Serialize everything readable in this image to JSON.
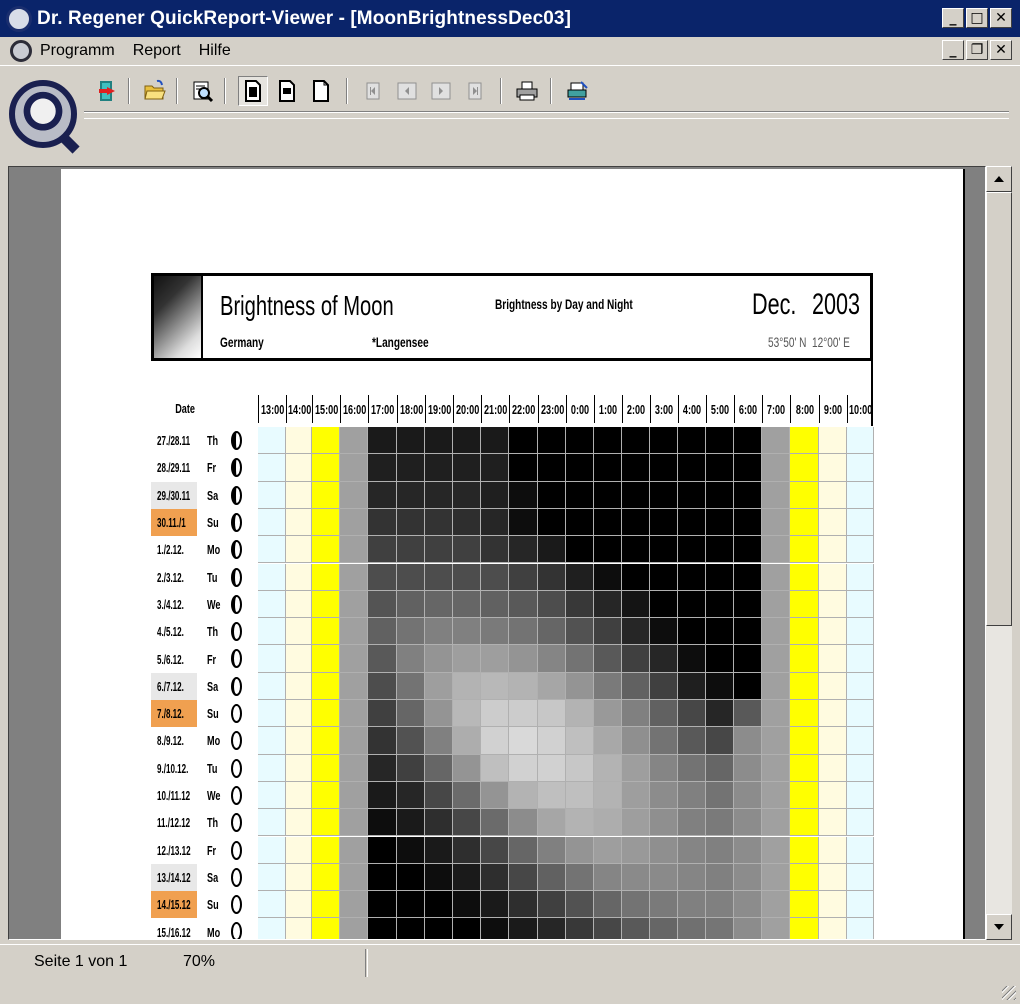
{
  "window": {
    "title": "Dr. Regener QuickReport-Viewer - [MoonBrightnessDec03]"
  },
  "menu": {
    "items": [
      "Programm",
      "Report",
      "Hilfe"
    ]
  },
  "toolbar": {
    "buttons": [
      "exit-icon",
      "open-folder-icon",
      "zoom-icon",
      "page-fit-icon",
      "page-width-icon",
      "page-100-icon",
      "first-page-icon",
      "prev-page-icon",
      "next-page-icon",
      "last-page-icon",
      "print-icon",
      "printer-setup-icon"
    ]
  },
  "report": {
    "title": "Brightness of Moon",
    "subtitle": "Brightness by Day and Night",
    "month": "Dec.",
    "year": "2003",
    "country": "Germany",
    "place": "*Langensee",
    "latitude": "53°50' N",
    "longitude": "12°00' E",
    "date_header": "Date",
    "hours": [
      "13:00",
      "14:00",
      "15:00",
      "16:00",
      "17:00",
      "18:00",
      "19:00",
      "20:00",
      "21:00",
      "22:00",
      "23:00",
      "0:00",
      "1:00",
      "2:00",
      "3:00",
      "4:00",
      "5:00",
      "6:00",
      "7:00",
      "8:00",
      "9:00",
      "10:00"
    ],
    "rows": [
      {
        "date": "27./28.11",
        "wd": "Th",
        "hl": "none"
      },
      {
        "date": "28./29.11",
        "wd": "Fr",
        "hl": "none"
      },
      {
        "date": "29./30.11",
        "wd": "Sa",
        "hl": "sat"
      },
      {
        "date": "30.11./1",
        "wd": "Su",
        "hl": "sun"
      },
      {
        "date": "1./2.12.",
        "wd": "Mo",
        "hl": "none"
      },
      {
        "date": "2./3.12.",
        "wd": "Tu",
        "hl": "none"
      },
      {
        "date": "3./4.12.",
        "wd": "We",
        "hl": "none"
      },
      {
        "date": "4./5.12.",
        "wd": "Th",
        "hl": "none"
      },
      {
        "date": "5./6.12.",
        "wd": "Fr",
        "hl": "none"
      },
      {
        "date": "6./7.12.",
        "wd": "Sa",
        "hl": "sat"
      },
      {
        "date": "7./8.12.",
        "wd": "Su",
        "hl": "sun"
      },
      {
        "date": "8./9.12.",
        "wd": "Mo",
        "hl": "none"
      },
      {
        "date": "9./10.12.",
        "wd": "Tu",
        "hl": "none"
      },
      {
        "date": "10./11.12",
        "wd": "We",
        "hl": "none"
      },
      {
        "date": "11./12.12",
        "wd": "Th",
        "hl": "none"
      },
      {
        "date": "12./13.12",
        "wd": "Fr",
        "hl": "none"
      },
      {
        "date": "13./14.12",
        "wd": "Sa",
        "hl": "sat"
      },
      {
        "date": "14./15.12",
        "wd": "Su",
        "hl": "sun"
      },
      {
        "date": "15./16.12",
        "wd": "Mo",
        "hl": "none"
      }
    ],
    "brightness_grid": [
      [
        0.1,
        0.1,
        0.1,
        0.1,
        0.1,
        0.0,
        0.0,
        0.0,
        0.0,
        0.0,
        0.0,
        0.0,
        0.0,
        0.0
      ],
      [
        0.12,
        0.12,
        0.12,
        0.12,
        0.12,
        0.0,
        0.0,
        0.0,
        0.0,
        0.0,
        0.0,
        0.0,
        0.0,
        0.0
      ],
      [
        0.15,
        0.15,
        0.15,
        0.15,
        0.12,
        0.05,
        0.0,
        0.0,
        0.0,
        0.0,
        0.0,
        0.0,
        0.0,
        0.0
      ],
      [
        0.2,
        0.2,
        0.2,
        0.18,
        0.15,
        0.05,
        0.0,
        0.0,
        0.0,
        0.0,
        0.0,
        0.0,
        0.0,
        0.0
      ],
      [
        0.25,
        0.25,
        0.25,
        0.25,
        0.2,
        0.15,
        0.1,
        0.0,
        0.0,
        0.0,
        0.0,
        0.0,
        0.0,
        0.0
      ],
      [
        0.3,
        0.3,
        0.3,
        0.3,
        0.3,
        0.25,
        0.2,
        0.12,
        0.05,
        0.0,
        0.0,
        0.0,
        0.0,
        0.0
      ],
      [
        0.33,
        0.38,
        0.4,
        0.4,
        0.38,
        0.35,
        0.3,
        0.22,
        0.15,
        0.08,
        0.0,
        0.0,
        0.0,
        0.0
      ],
      [
        0.38,
        0.45,
        0.5,
        0.5,
        0.48,
        0.45,
        0.4,
        0.32,
        0.25,
        0.15,
        0.05,
        0.0,
        0.0,
        0.0
      ],
      [
        0.35,
        0.5,
        0.58,
        0.62,
        0.62,
        0.58,
        0.52,
        0.45,
        0.35,
        0.25,
        0.15,
        0.05,
        0.0,
        0.0
      ],
      [
        0.3,
        0.45,
        0.62,
        0.7,
        0.72,
        0.7,
        0.65,
        0.58,
        0.48,
        0.38,
        0.25,
        0.12,
        0.05,
        0.0
      ],
      [
        0.25,
        0.4,
        0.58,
        0.72,
        0.8,
        0.8,
        0.78,
        0.7,
        0.6,
        0.5,
        0.38,
        0.28,
        0.15,
        0.35
      ],
      [
        0.2,
        0.32,
        0.5,
        0.68,
        0.82,
        0.85,
        0.82,
        0.75,
        0.66,
        0.56,
        0.45,
        0.35,
        0.28,
        0.55
      ],
      [
        0.15,
        0.25,
        0.4,
        0.58,
        0.75,
        0.82,
        0.82,
        0.78,
        0.7,
        0.62,
        0.52,
        0.45,
        0.4,
        0.55
      ],
      [
        0.1,
        0.15,
        0.28,
        0.42,
        0.58,
        0.7,
        0.75,
        0.75,
        0.7,
        0.62,
        0.55,
        0.5,
        0.45,
        0.55
      ],
      [
        0.05,
        0.1,
        0.18,
        0.28,
        0.42,
        0.55,
        0.65,
        0.7,
        0.68,
        0.62,
        0.56,
        0.5,
        0.48,
        0.55
      ],
      [
        0.0,
        0.05,
        0.1,
        0.18,
        0.28,
        0.4,
        0.5,
        0.58,
        0.62,
        0.6,
        0.56,
        0.52,
        0.5,
        0.55
      ],
      [
        0.0,
        0.0,
        0.05,
        0.1,
        0.18,
        0.28,
        0.38,
        0.45,
        0.52,
        0.54,
        0.54,
        0.52,
        0.5,
        0.55
      ],
      [
        0.0,
        0.0,
        0.0,
        0.05,
        0.1,
        0.18,
        0.25,
        0.32,
        0.4,
        0.45,
        0.48,
        0.5,
        0.5,
        0.55
      ],
      [
        0.0,
        0.0,
        0.0,
        0.0,
        0.05,
        0.1,
        0.15,
        0.22,
        0.28,
        0.35,
        0.4,
        0.44,
        0.46,
        0.55
      ]
    ],
    "colors": {
      "day_cyan": "#e8fbff",
      "day_cream": "#fffbe0",
      "sun_yellow": "#ffff00",
      "twilight_gray": "#a0a0a0",
      "sunday_orange": "#f0a050",
      "saturday_gray": "#e8e8e8"
    }
  },
  "status": {
    "page": "Seite 1 von 1",
    "zoom": "70%"
  }
}
